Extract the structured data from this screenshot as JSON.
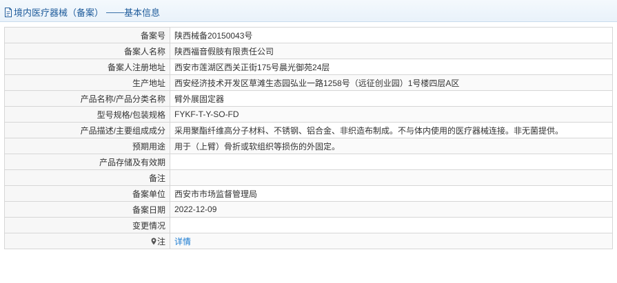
{
  "header": {
    "title": "境内医疗器械（备案）",
    "separator": "——",
    "subtitle": "基本信息",
    "icon": "document-icon"
  },
  "rows": [
    {
      "label": "备案号",
      "value": "陕西械备20150043号"
    },
    {
      "label": "备案人名称",
      "value": "陕西福音假肢有限责任公司"
    },
    {
      "label": "备案人注册地址",
      "value": "西安市莲湖区西关正街175号晨光御苑24层"
    },
    {
      "label": "生产地址",
      "value": "西安经济技术开发区草滩生态园弘业一路1258号（远征创业园）1号楼四层A区"
    },
    {
      "label": "产品名称/产品分类名称",
      "value": "臂外展固定器"
    },
    {
      "label": "型号规格/包装规格",
      "value": "FYKF-T-Y-SO-FD"
    },
    {
      "label": "产品描述/主要组成成分",
      "value": "采用聚酯纤维高分子材料、不锈钢、铝合金、非织造布制成。不与体内使用的医疗器械连接。非无菌提供。"
    },
    {
      "label": "预期用途",
      "value": "用于（上臂）骨折或软组织等损伤的外固定。"
    },
    {
      "label": "产品存储及有效期",
      "value": ""
    },
    {
      "label": "备注",
      "value": ""
    },
    {
      "label": "备案单位",
      "value": "西安市市场监督管理局"
    },
    {
      "label": "备案日期",
      "value": "2022-12-09"
    },
    {
      "label": "变更情况",
      "value": ""
    }
  ],
  "note_row": {
    "label": "注",
    "icon": "pin-icon",
    "link_text": "详情",
    "link_color": "#1a7bd1"
  },
  "colors": {
    "header_text": "#1c5a9a",
    "border": "#d6d6d6",
    "label_bg": "#f7f7f7"
  }
}
